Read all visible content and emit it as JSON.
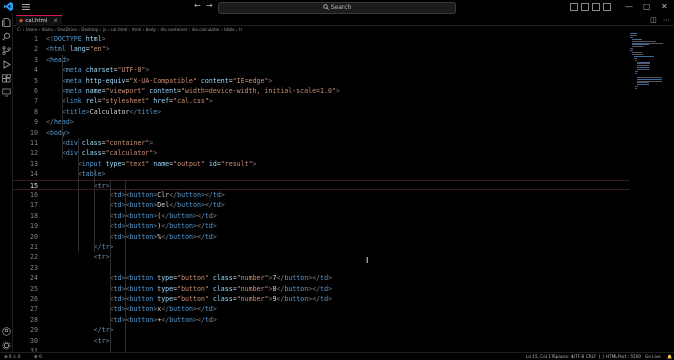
{
  "titlebar": {
    "nav_back": "←",
    "nav_forward": "→",
    "search_label": "Search"
  },
  "tabs": [
    {
      "label": "cal.html",
      "close": "×"
    }
  ],
  "breadcrumb": "C: › Users › dazio › OneDrive › Desktop › js › cal.html › html › body › div.container › div.calculator › table › tr",
  "lines": [
    {
      "n": "1",
      "tokens": [
        [
          "<!",
          "p"
        ],
        [
          "DOCTYPE",
          "t"
        ],
        [
          " html",
          "a"
        ],
        [
          ">",
          "p"
        ]
      ]
    },
    {
      "n": "2",
      "tokens": [
        [
          "<",
          "p"
        ],
        [
          "html",
          "t"
        ],
        [
          " lang",
          "a"
        ],
        [
          "=",
          "x"
        ],
        [
          "\"en\"",
          "s"
        ],
        [
          ">",
          "p"
        ]
      ]
    },
    {
      "n": "3",
      "tokens": [
        [
          "<",
          "p"
        ],
        [
          "head",
          "t"
        ],
        [
          ">",
          "p"
        ]
      ]
    },
    {
      "n": "4",
      "tokens": [
        [
          "    ",
          "x"
        ],
        [
          "<",
          "p"
        ],
        [
          "meta",
          "t"
        ],
        [
          " charset",
          "a"
        ],
        [
          "=",
          "x"
        ],
        [
          "\"UTF-8\"",
          "s"
        ],
        [
          ">",
          "p"
        ]
      ]
    },
    {
      "n": "5",
      "tokens": [
        [
          "    ",
          "x"
        ],
        [
          "<",
          "p"
        ],
        [
          "meta",
          "t"
        ],
        [
          " http-equiv",
          "a"
        ],
        [
          "=",
          "x"
        ],
        [
          "\"X-UA-Compatible\"",
          "s"
        ],
        [
          " content",
          "a"
        ],
        [
          "=",
          "x"
        ],
        [
          "\"IE=edge\"",
          "s"
        ],
        [
          ">",
          "p"
        ]
      ]
    },
    {
      "n": "6",
      "tokens": [
        [
          "    ",
          "x"
        ],
        [
          "<",
          "p"
        ],
        [
          "meta",
          "t"
        ],
        [
          " name",
          "a"
        ],
        [
          "=",
          "x"
        ],
        [
          "\"viewport\"",
          "s"
        ],
        [
          " content",
          "a"
        ],
        [
          "=",
          "x"
        ],
        [
          "\"width=device-width, initial-scale=1.0\"",
          "s"
        ],
        [
          ">",
          "p"
        ]
      ]
    },
    {
      "n": "7",
      "tokens": [
        [
          "    ",
          "x"
        ],
        [
          "<",
          "p"
        ],
        [
          "link",
          "t"
        ],
        [
          " rel",
          "a"
        ],
        [
          "=",
          "x"
        ],
        [
          "\"stylesheet\"",
          "s"
        ],
        [
          " href",
          "a"
        ],
        [
          "=",
          "x"
        ],
        [
          "\"cal.css\"",
          "s"
        ],
        [
          ">",
          "p"
        ]
      ]
    },
    {
      "n": "8",
      "tokens": [
        [
          "    ",
          "x"
        ],
        [
          "<",
          "p"
        ],
        [
          "title",
          "t"
        ],
        [
          ">",
          "p"
        ],
        [
          "Calculator",
          "x"
        ],
        [
          "</",
          "p"
        ],
        [
          "title",
          "t"
        ],
        [
          ">",
          "p"
        ]
      ]
    },
    {
      "n": "9",
      "tokens": [
        [
          "</",
          "p"
        ],
        [
          "head",
          "t"
        ],
        [
          ">",
          "p"
        ]
      ]
    },
    {
      "n": "10",
      "tokens": [
        [
          "<",
          "p"
        ],
        [
          "body",
          "t"
        ],
        [
          ">",
          "p"
        ]
      ]
    },
    {
      "n": "11",
      "tokens": [
        [
          "    ",
          "x"
        ],
        [
          "<",
          "p"
        ],
        [
          "div",
          "t"
        ],
        [
          " class",
          "a"
        ],
        [
          "=",
          "x"
        ],
        [
          "\"container\"",
          "s"
        ],
        [
          ">",
          "p"
        ]
      ]
    },
    {
      "n": "12",
      "tokens": [
        [
          "    ",
          "x"
        ],
        [
          "<",
          "p"
        ],
        [
          "div",
          "t"
        ],
        [
          " class",
          "a"
        ],
        [
          "=",
          "x"
        ],
        [
          "\"calculator\"",
          "s"
        ],
        [
          ">",
          "p"
        ]
      ]
    },
    {
      "n": "13",
      "tokens": [
        [
          "        ",
          "x"
        ],
        [
          "<",
          "p"
        ],
        [
          "input",
          "t"
        ],
        [
          " type",
          "a"
        ],
        [
          "=",
          "x"
        ],
        [
          "\"text\"",
          "s"
        ],
        [
          " name",
          "a"
        ],
        [
          "=",
          "x"
        ],
        [
          "\"output\"",
          "s"
        ],
        [
          " id",
          "a"
        ],
        [
          "=",
          "x"
        ],
        [
          "\"result\"",
          "s"
        ],
        [
          ">",
          "p"
        ]
      ]
    },
    {
      "n": "14",
      "tokens": [
        [
          "        ",
          "x"
        ],
        [
          "<",
          "p"
        ],
        [
          "table",
          "t"
        ],
        [
          ">",
          "p"
        ]
      ]
    },
    {
      "n": "15",
      "tokens": [
        [
          "            ",
          "x"
        ],
        [
          "<",
          "p"
        ],
        [
          "tr",
          "t"
        ],
        [
          ">",
          "p"
        ]
      ]
    },
    {
      "n": "16",
      "tokens": [
        [
          "                ",
          "x"
        ],
        [
          "<",
          "p"
        ],
        [
          "td",
          "t"
        ],
        [
          ">",
          "p"
        ],
        [
          "<",
          "p"
        ],
        [
          "button",
          "t"
        ],
        [
          ">",
          "p"
        ],
        [
          "Clr",
          "x"
        ],
        [
          "</",
          "p"
        ],
        [
          "button",
          "t"
        ],
        [
          ">",
          "p"
        ],
        [
          "</",
          "p"
        ],
        [
          "td",
          "t"
        ],
        [
          ">",
          "p"
        ]
      ]
    },
    {
      "n": "17",
      "tokens": [
        [
          "                ",
          "x"
        ],
        [
          "<",
          "p"
        ],
        [
          "td",
          "t"
        ],
        [
          ">",
          "p"
        ],
        [
          "<",
          "p"
        ],
        [
          "button",
          "t"
        ],
        [
          ">",
          "p"
        ],
        [
          "Del",
          "x"
        ],
        [
          "</",
          "p"
        ],
        [
          "button",
          "t"
        ],
        [
          ">",
          "p"
        ],
        [
          "</",
          "p"
        ],
        [
          "td",
          "t"
        ],
        [
          ">",
          "p"
        ]
      ]
    },
    {
      "n": "18",
      "tokens": [
        [
          "                ",
          "x"
        ],
        [
          "<",
          "p"
        ],
        [
          "td",
          "t"
        ],
        [
          ">",
          "p"
        ],
        [
          "<",
          "p"
        ],
        [
          "button",
          "t"
        ],
        [
          ">",
          "p"
        ],
        [
          "(",
          "x"
        ],
        [
          "</",
          "p"
        ],
        [
          "button",
          "t"
        ],
        [
          ">",
          "p"
        ],
        [
          "</",
          "p"
        ],
        [
          "td",
          "t"
        ],
        [
          ">",
          "p"
        ]
      ]
    },
    {
      "n": "19",
      "tokens": [
        [
          "                ",
          "x"
        ],
        [
          "<",
          "p"
        ],
        [
          "td",
          "t"
        ],
        [
          ">",
          "p"
        ],
        [
          "<",
          "p"
        ],
        [
          "button",
          "t"
        ],
        [
          ">",
          "p"
        ],
        [
          ")",
          "x"
        ],
        [
          "</",
          "p"
        ],
        [
          "button",
          "t"
        ],
        [
          ">",
          "p"
        ],
        [
          "</",
          "p"
        ],
        [
          "td",
          "t"
        ],
        [
          ">",
          "p"
        ]
      ]
    },
    {
      "n": "20",
      "tokens": [
        [
          "                ",
          "x"
        ],
        [
          "<",
          "p"
        ],
        [
          "td",
          "t"
        ],
        [
          ">",
          "p"
        ],
        [
          "<",
          "p"
        ],
        [
          "button",
          "t"
        ],
        [
          ">",
          "p"
        ],
        [
          "%",
          "x"
        ],
        [
          "</",
          "p"
        ],
        [
          "button",
          "t"
        ],
        [
          ">",
          "p"
        ],
        [
          "</",
          "p"
        ],
        [
          "td",
          "t"
        ],
        [
          ">",
          "p"
        ]
      ]
    },
    {
      "n": "21",
      "tokens": [
        [
          "            ",
          "x"
        ],
        [
          "</",
          "p"
        ],
        [
          "tr",
          "t"
        ],
        [
          ">",
          "p"
        ]
      ]
    },
    {
      "n": "22",
      "tokens": [
        [
          "            ",
          "x"
        ],
        [
          "<",
          "p"
        ],
        [
          "tr",
          "t"
        ],
        [
          ">",
          "p"
        ]
      ]
    },
    {
      "n": "23",
      "tokens": []
    },
    {
      "n": "24",
      "tokens": [
        [
          "                ",
          "x"
        ],
        [
          "<",
          "p"
        ],
        [
          "td",
          "t"
        ],
        [
          ">",
          "p"
        ],
        [
          "<",
          "p"
        ],
        [
          "button",
          "t"
        ],
        [
          " type",
          "a"
        ],
        [
          "=",
          "x"
        ],
        [
          "\"button\"",
          "s"
        ],
        [
          " class",
          "a"
        ],
        [
          "=",
          "x"
        ],
        [
          "\"number\"",
          "s"
        ],
        [
          ">",
          "p"
        ],
        [
          "7",
          "x"
        ],
        [
          "</",
          "p"
        ],
        [
          "button",
          "t"
        ],
        [
          ">",
          "p"
        ],
        [
          "</",
          "p"
        ],
        [
          "td",
          "t"
        ],
        [
          ">",
          "p"
        ]
      ]
    },
    {
      "n": "25",
      "tokens": [
        [
          "                ",
          "x"
        ],
        [
          "<",
          "p"
        ],
        [
          "td",
          "t"
        ],
        [
          ">",
          "p"
        ],
        [
          "<",
          "p"
        ],
        [
          "button",
          "t"
        ],
        [
          " type",
          "a"
        ],
        [
          "=",
          "x"
        ],
        [
          "\"button\"",
          "s"
        ],
        [
          " class",
          "a"
        ],
        [
          "=",
          "x"
        ],
        [
          "\"number\"",
          "s"
        ],
        [
          ">",
          "p"
        ],
        [
          "8",
          "x"
        ],
        [
          "</",
          "p"
        ],
        [
          "button",
          "t"
        ],
        [
          ">",
          "p"
        ],
        [
          "</",
          "p"
        ],
        [
          "td",
          "t"
        ],
        [
          ">",
          "p"
        ]
      ]
    },
    {
      "n": "26",
      "tokens": [
        [
          "                ",
          "x"
        ],
        [
          "<",
          "p"
        ],
        [
          "td",
          "t"
        ],
        [
          ">",
          "p"
        ],
        [
          "<",
          "p"
        ],
        [
          "button",
          "t"
        ],
        [
          " type",
          "a"
        ],
        [
          "=",
          "x"
        ],
        [
          "\"button\"",
          "s"
        ],
        [
          " class",
          "a"
        ],
        [
          "=",
          "x"
        ],
        [
          "\"number\"",
          "s"
        ],
        [
          ">",
          "p"
        ],
        [
          "9",
          "x"
        ],
        [
          "</",
          "p"
        ],
        [
          "button",
          "t"
        ],
        [
          ">",
          "p"
        ],
        [
          "</",
          "p"
        ],
        [
          "td",
          "t"
        ],
        [
          ">",
          "p"
        ]
      ]
    },
    {
      "n": "27",
      "tokens": [
        [
          "                ",
          "x"
        ],
        [
          "<",
          "p"
        ],
        [
          "td",
          "t"
        ],
        [
          ">",
          "p"
        ],
        [
          "<",
          "p"
        ],
        [
          "button",
          "t"
        ],
        [
          ">",
          "p"
        ],
        [
          "x",
          "x"
        ],
        [
          "</",
          "p"
        ],
        [
          "button",
          "t"
        ],
        [
          ">",
          "p"
        ],
        [
          "</",
          "p"
        ],
        [
          "td",
          "t"
        ],
        [
          ">",
          "p"
        ]
      ]
    },
    {
      "n": "28",
      "tokens": [
        [
          "                ",
          "x"
        ],
        [
          "<",
          "p"
        ],
        [
          "td",
          "t"
        ],
        [
          ">",
          "p"
        ],
        [
          "<",
          "p"
        ],
        [
          "button",
          "t"
        ],
        [
          ">",
          "p"
        ],
        [
          "+",
          "x"
        ],
        [
          "</",
          "p"
        ],
        [
          "button",
          "t"
        ],
        [
          ">",
          "p"
        ],
        [
          "</",
          "p"
        ],
        [
          "td",
          "t"
        ],
        [
          ">",
          "p"
        ]
      ]
    },
    {
      "n": "29",
      "tokens": [
        [
          "            ",
          "x"
        ],
        [
          "</",
          "p"
        ],
        [
          "tr",
          "t"
        ],
        [
          ">",
          "p"
        ]
      ]
    },
    {
      "n": "30",
      "tokens": [
        [
          "            ",
          "x"
        ],
        [
          "<",
          "p"
        ],
        [
          "tr",
          "t"
        ],
        [
          ">",
          "p"
        ]
      ]
    },
    {
      "n": "31",
      "tokens": []
    }
  ],
  "current_line": "15",
  "statusbar": {
    "left": "⊗ 0 ⚠ 0",
    "extra": "⚙ 0",
    "position": "Ln 15, Col 17",
    "spaces": "Spaces: 4",
    "encoding": "UTF-8",
    "eol": "CRLF",
    "language": "{ } HTML",
    "port": "Port : 5500",
    "golive": "Go Live"
  },
  "colors": {
    "tag": "#569cd6",
    "attr": "#9cdcfe",
    "string": "#ce9178",
    "punct": "#808080",
    "text": "#d4d4d4"
  }
}
